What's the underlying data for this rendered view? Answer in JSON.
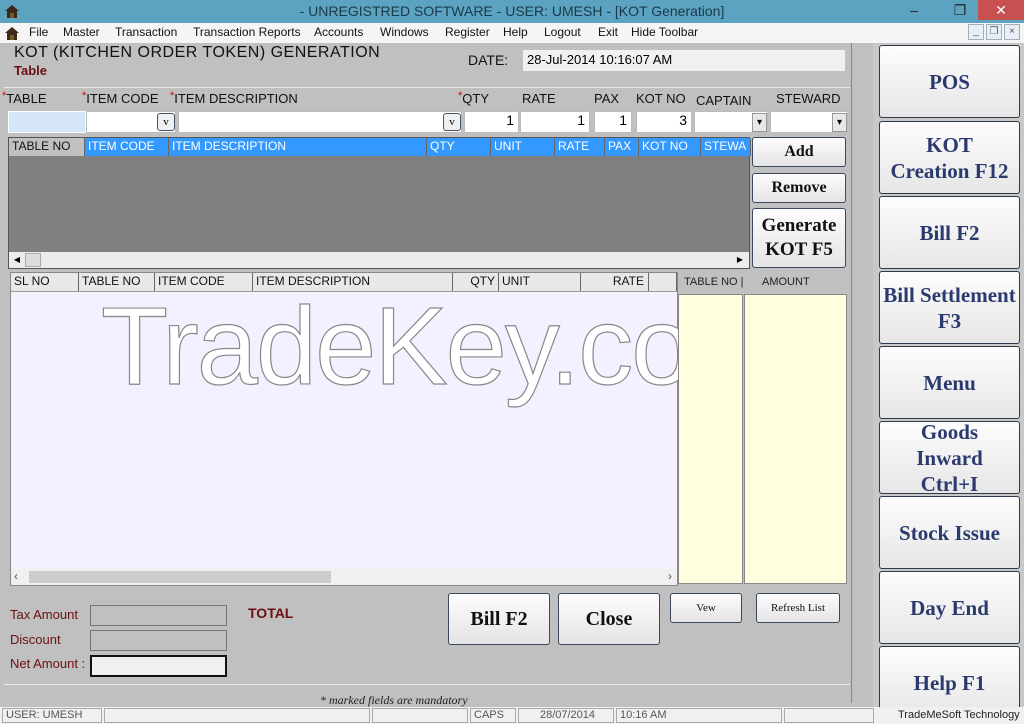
{
  "window": {
    "title": "- UNREGISTRED SOFTWARE - USER: UMESH - [KOT Generation]",
    "minimize": "‒",
    "restore": "❐",
    "close": "✕"
  },
  "menu": {
    "items": [
      "File",
      "Master",
      "Transaction",
      "Transaction Reports",
      "Accounts",
      "Windows",
      "Register",
      "Help",
      "Logout",
      "Exit",
      "Hide Toolbar"
    ],
    "mdi_min": "_",
    "mdi_restore": "❐",
    "mdi_close": "×"
  },
  "form": {
    "heading": "KOT  (KITCHEN ORDER TOKEN) GENERATION",
    "subheading": "Table",
    "date_label": "DATE:",
    "date_value": "28-Jul-2014 10:16:07 AM"
  },
  "entry": {
    "labels": {
      "table": "TABLE",
      "item_code": "ITEM CODE",
      "item_description": "ITEM DESCRIPTION",
      "qty": "QTY",
      "rate": "RATE",
      "pax": "PAX",
      "kot_no": "KOT NO",
      "captain": "CAPTAIN",
      "steward": "STEWARD"
    },
    "values": {
      "table": "",
      "item_code": "",
      "item_description": "",
      "qty": "1",
      "rate": "1",
      "pax": "1",
      "kot_no": "3",
      "captain": "",
      "steward": ""
    },
    "lookup_btn": "v",
    "dropdown_arrow": "▾"
  },
  "kot_grid": {
    "columns": [
      "TABLE NO",
      "ITEM CODE",
      "ITEM DESCRIPTION",
      "QTY",
      "UNIT",
      "RATE",
      "PAX",
      "KOT NO",
      "STEWA"
    ],
    "rows": []
  },
  "buttons": {
    "add": "Add",
    "remove": "Remove",
    "generate_line1": "Generate",
    "generate_line2": "KOT F5",
    "bill": "Bill F2",
    "close": "Close",
    "view": "Vew",
    "refresh": "Refresh List"
  },
  "detail_grid": {
    "columns": [
      "SL NO",
      "TABLE NO",
      "ITEM CODE",
      "ITEM DESCRIPTION",
      "QTY",
      "UNIT",
      "RATE",
      ""
    ],
    "rows": []
  },
  "summary_grid": {
    "columns": [
      "TABLE NO  |",
      "AMOUNT"
    ],
    "rows": []
  },
  "totals": {
    "tax_label": "Tax Amount",
    "discount_label": "Discount",
    "net_label": "Net Amount :",
    "total_label": "TOTAL",
    "tax_value": "",
    "discount_value": "",
    "net_value": ""
  },
  "footer_note": "*   marked fields are mandatory",
  "watermark": "TradeKey.com",
  "sidebar": {
    "items": [
      "POS",
      "KOT Creation F12",
      "Bill F2",
      "Bill Settlement F3",
      "Menu",
      "Goods Inward Ctrl+I",
      "Stock Issue",
      "Day End",
      "Help F1"
    ]
  },
  "statusbar": {
    "user": "USER: UMESH",
    "caps": "CAPS",
    "date": "28/07/2014",
    "time": "10:16 AM",
    "company": "TradeMeSoft Technology"
  },
  "colors": {
    "titlebar": "#5ba3c0",
    "grid_header_selected": "#3399ff",
    "sidebar_text": "#2b3a6e",
    "label_dark_red": "#6b0f0f",
    "summary_bg": "#ffffe0",
    "detail_bg": "#f4f0ff"
  }
}
